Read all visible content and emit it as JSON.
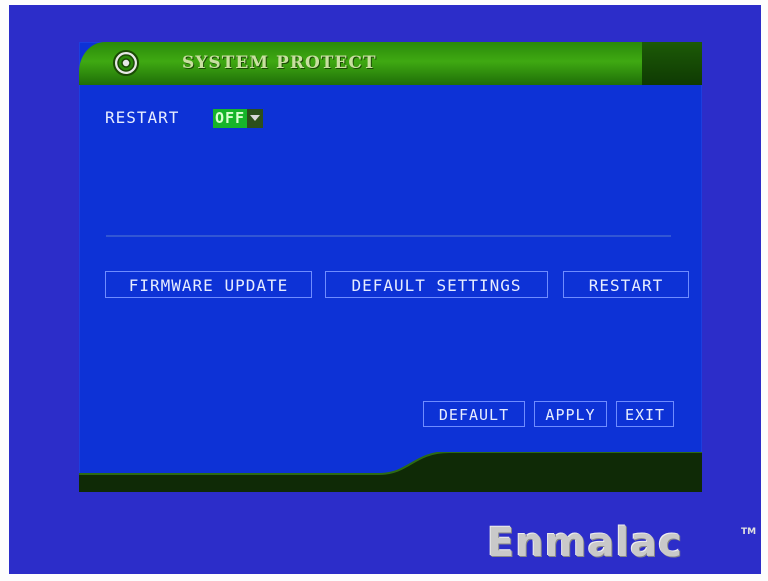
{
  "window": {
    "title": "SYSTEM PROTECT",
    "icon": "gear-icon"
  },
  "restart_setting": {
    "label": "RESTART",
    "value": "OFF"
  },
  "actions": {
    "firmware_update": "FIRMWARE UPDATE",
    "default_settings": "DEFAULT SETTINGS",
    "restart": "RESTART"
  },
  "footer_buttons": {
    "default": "DEFAULT",
    "apply": "APPLY",
    "exit": "EXIT"
  },
  "watermark": {
    "brand": "Enmalac",
    "tm": "TM"
  },
  "colors": {
    "screen_bg": "#2c2dc9",
    "panel_bg": "#0d32d6",
    "title_green": "#3fa912",
    "select_green": "#17b52a",
    "footer_dark": "#0f2a06",
    "button_border": "#6f8cff"
  }
}
